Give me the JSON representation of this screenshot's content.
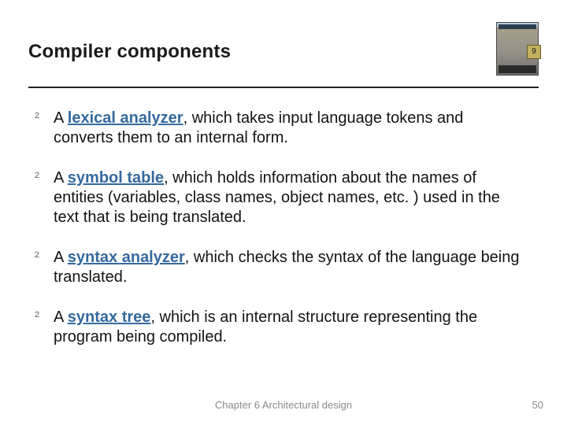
{
  "title": "Compiler components",
  "thumb_badge": "9",
  "bullet_glyph": "²",
  "items": [
    {
      "prefix": "A ",
      "term": "lexical analyzer",
      "suffix": ", which takes input language tokens and converts them to an internal form."
    },
    {
      "prefix": "A ",
      "term": "symbol table",
      "suffix": ", which holds information about the names of entities (variables, class names, object names, etc. ) used in the text that is being translated."
    },
    {
      "prefix": "A ",
      "term": "syntax analyzer",
      "suffix": ", which checks the syntax of the language being translated."
    },
    {
      "prefix": "A ",
      "term": "syntax tree",
      "suffix": ", which is an internal structure representing the program being compiled."
    }
  ],
  "footer": {
    "center": "Chapter 6 Architectural design",
    "page": "50"
  }
}
